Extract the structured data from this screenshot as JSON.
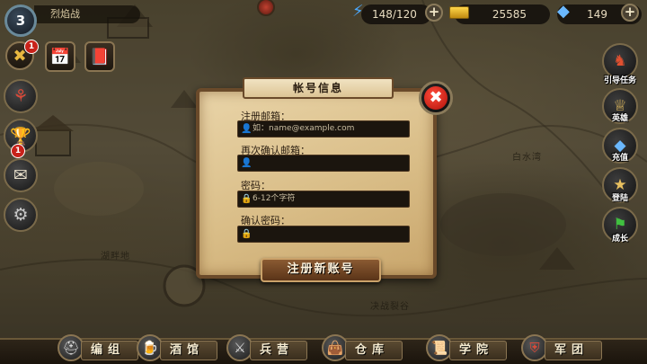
{
  "player": {
    "level": "3",
    "name": "烈焰战"
  },
  "resources": {
    "energy": "148/120",
    "gold": "25585",
    "gems": "149"
  },
  "map": {
    "labels": [
      "白水湾",
      "湖畔地",
      "决战裂谷"
    ]
  },
  "left_badges": {
    "quest_badge": "1",
    "trophy_badge": "1"
  },
  "right_menu": {
    "items": [
      {
        "label": "引导任务",
        "icon": "knight-icon"
      },
      {
        "label": "英雄",
        "icon": "hero-icon"
      },
      {
        "label": "充值",
        "icon": "gem-icon"
      },
      {
        "label": "登陆",
        "icon": "login-icon"
      },
      {
        "label": "成长",
        "icon": "growth-icon"
      }
    ]
  },
  "bottom_nav": [
    {
      "label": "编组",
      "icon": "helmet-icon"
    },
    {
      "label": "酒馆",
      "icon": "tavern-icon"
    },
    {
      "label": "兵营",
      "icon": "swords-icon"
    },
    {
      "label": "仓库",
      "icon": "bag-icon"
    },
    {
      "label": "学院",
      "icon": "scroll-icon"
    },
    {
      "label": "军团",
      "icon": "shield-icon"
    }
  ],
  "dialog": {
    "title": "帐号信息",
    "email_label": "注册邮箱：",
    "email_placeholder": "如：name@example.com",
    "confirm_email_label": "再次确认邮箱：",
    "confirm_email_placeholder": "",
    "password_label": "密码：",
    "password_placeholder": "6-12个字符",
    "confirm_password_label": "确认密码：",
    "confirm_password_placeholder": "",
    "register_button": "注册新账号"
  },
  "colors": {
    "dialog_paper": "#d9bd87",
    "dialog_border": "#6a4a2a",
    "close_red": "#e0281c",
    "field_bg": "#1b150e"
  }
}
